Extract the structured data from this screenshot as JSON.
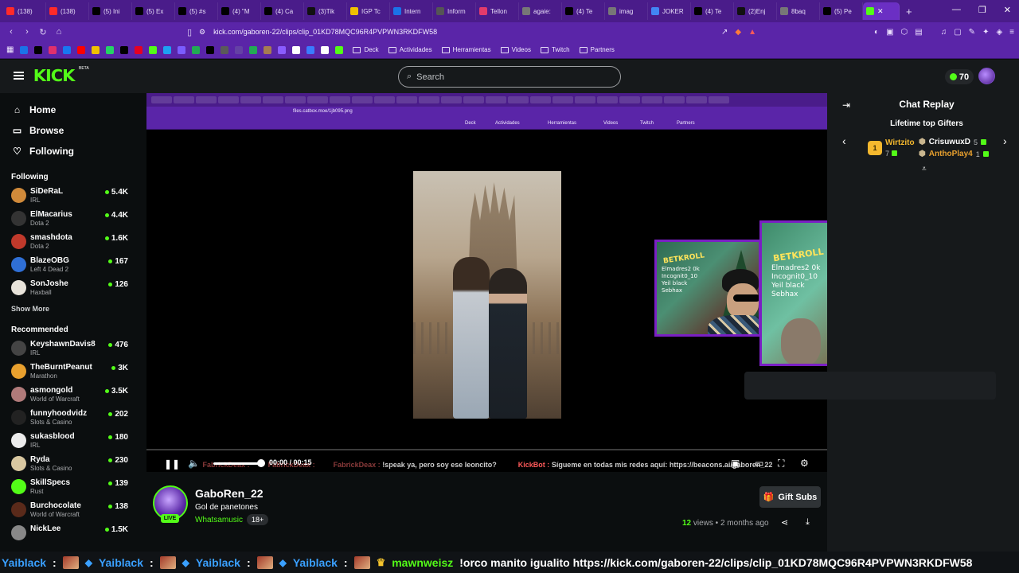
{
  "browser": {
    "tabs": [
      {
        "label": "(138)",
        "color": "#ff2a2a"
      },
      {
        "label": "(138)",
        "color": "#ff2a2a"
      },
      {
        "label": "(5) Ini",
        "color": "#000000"
      },
      {
        "label": "(5) Ex",
        "color": "#000000"
      },
      {
        "label": "(5) #s",
        "color": "#000000"
      },
      {
        "label": "(4) \"M",
        "color": "#000000"
      },
      {
        "label": "(4) Ca",
        "color": "#000000"
      },
      {
        "label": "(3)Tik",
        "color": "#111111"
      },
      {
        "label": "IGP Tc",
        "color": "#f0c000"
      },
      {
        "label": "Intern",
        "color": "#1a73e8"
      },
      {
        "label": "Inform",
        "color": "#555555"
      },
      {
        "label": "Tellon",
        "color": "#e23b6b"
      },
      {
        "label": "agaie:",
        "color": "#777777"
      },
      {
        "label": "(4) Te",
        "color": "#000000"
      },
      {
        "label": "imag",
        "color": "#777777"
      },
      {
        "label": "JOKER",
        "color": "#4285f4"
      },
      {
        "label": "(4) Te",
        "color": "#000000"
      },
      {
        "label": "(2)Enj",
        "color": "#111111"
      },
      {
        "label": "8baq",
        "color": "#777777"
      },
      {
        "label": "(5) Pe",
        "color": "#000000"
      }
    ],
    "active_tab_close": "✕",
    "new_tab": "+",
    "url": "kick.com/gaboren-22/clips/clip_01KD78MQC96R4PVPWN3RKDFW58",
    "bookmarks": [
      {
        "label": "Deck"
      },
      {
        "label": "Actividades"
      },
      {
        "label": "Herramientas"
      },
      {
        "label": "Videos"
      },
      {
        "label": "Twitch"
      },
      {
        "label": "Partners"
      }
    ]
  },
  "kick": {
    "logo": "KICK",
    "beta": "BETA",
    "search_placeholder": "Search",
    "coins": "70"
  },
  "sidebar": {
    "nav": [
      {
        "label": "Home",
        "icon": "home-icon",
        "glyph": "⌂"
      },
      {
        "label": "Browse",
        "icon": "browse-icon",
        "glyph": "▭"
      },
      {
        "label": "Following",
        "icon": "heart-icon",
        "glyph": "♡"
      }
    ],
    "following_heading": "Following",
    "following": [
      {
        "name": "SiDeRaL",
        "category": "IRL",
        "viewers": "5.4K",
        "color": "#d08a3a"
      },
      {
        "name": "ElMacarius",
        "category": "Dota 2",
        "viewers": "4.4K",
        "color": "#333333"
      },
      {
        "name": "smashdota",
        "category": "Dota 2",
        "viewers": "1.6K",
        "color": "#c0392b"
      },
      {
        "name": "BlazeOBG",
        "category": "Left 4 Dead 2",
        "viewers": "167",
        "color": "#2f6fd6"
      },
      {
        "name": "SonJoshe",
        "category": "Haxball",
        "viewers": "126",
        "color": "#e8e3da"
      }
    ],
    "show_more": "Show More",
    "recommended_heading": "Recommended",
    "recommended": [
      {
        "name": "KeyshawnDavis8",
        "category": "IRL",
        "viewers": "476",
        "color": "#444444"
      },
      {
        "name": "TheBurntPeanut",
        "category": "Marathon",
        "viewers": "3K",
        "color": "#e8a02e"
      },
      {
        "name": "asmongold",
        "category": "World of Warcraft",
        "viewers": "3.5K",
        "color": "#b07a7a"
      },
      {
        "name": "funnyhoodvidz",
        "category": "Slots & Casino",
        "viewers": "202",
        "color": "#222222"
      },
      {
        "name": "sukasblood",
        "category": "IRL",
        "viewers": "180",
        "color": "#ececec"
      },
      {
        "name": "Ryda",
        "category": "Slots & Casino",
        "viewers": "230",
        "color": "#d8c7a0"
      },
      {
        "name": "SkillSpecs",
        "category": "Rust",
        "viewers": "139",
        "color": "#53fc18"
      },
      {
        "name": "Burchocolate",
        "category": "World of Warcraft",
        "viewers": "138",
        "color": "#5a2a1a"
      },
      {
        "name": "NickLee",
        "category": "",
        "viewers": "1.5K",
        "color": "#888888"
      }
    ]
  },
  "player": {
    "inner_url": "files.catbox.moe/1jb095.png",
    "inner_bookmarks": [
      "Deck",
      "Actividades",
      "Herramientas",
      "Videos",
      "Twitch",
      "Partners"
    ],
    "time": "00:00 / 00:15",
    "ticker_inline": {
      "u1": "FabrickDeax :",
      "u2": "FabrickDeax :",
      "u3": "FabrickDeax :",
      "msg1": "!speak ya, pero soy ese leoncito?",
      "u4": "KickBot :",
      "msg2": "Sígueme en todas mis redes aquí: https://beacons.ai/gaboren_22"
    },
    "overlay": {
      "sign": "BETKROLL",
      "board_lines": [
        "Elmadres2 0k",
        "Incognit0_10",
        "Yeil black",
        "Sebhax"
      ]
    }
  },
  "chat": {
    "title": "Chat Replay",
    "gifters_title": "Lifetime top Gifters",
    "gifters": [
      {
        "rank": "1",
        "name": "Wirtzito",
        "count": "7",
        "color": "#f5b82e"
      },
      {
        "rank": "2",
        "name": "CrisuwuxD",
        "count": "5",
        "color": "#ffffff"
      },
      {
        "rank": "3",
        "name": "AnthoPlay4",
        "count": "1",
        "color": "#e8a02e"
      }
    ]
  },
  "clip": {
    "streamer": "GaboRen_22",
    "live": "LIVE",
    "title": "Gol de panetones",
    "category": "Whatsamusic",
    "age": "18+",
    "gift_button": "Gift Subs",
    "views_count": "12",
    "views_label": " views • 2 months ago"
  },
  "ticker": {
    "user": "Yaiblack",
    "sep": ":",
    "last_user": "mawnweisz",
    "message": "!orco manito igualito https://kick.com/gaboren-22/clips/clip_01KD78MQC96R4PVPWN3RKDFW58"
  }
}
